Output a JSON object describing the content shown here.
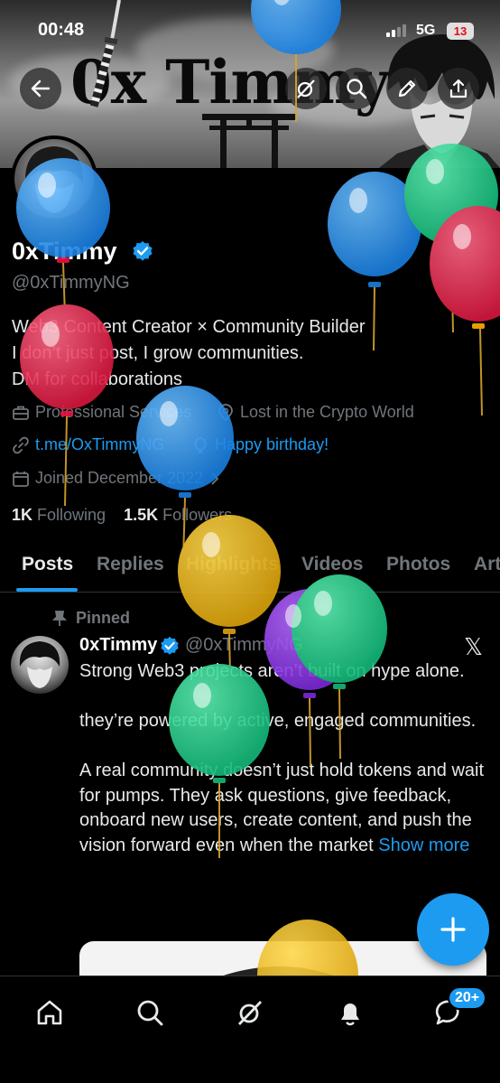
{
  "status_bar": {
    "time": "00:48",
    "network": "5G",
    "battery": "13"
  },
  "banner": {
    "title": "0x Timmy"
  },
  "profile": {
    "display_name": "0xTimmy",
    "handle": "@0xTimmyNG",
    "bio_lines": [
      "Web3 Content Creator × Community Builder",
      "I don’t just post, I grow communities.",
      "DM for collaborations"
    ],
    "category": "Professional Services",
    "location": "Lost in the Crypto World",
    "website": "t.me/OxTimmyNG",
    "birthday": "Happy birthday!",
    "joined": "Joined December 2022",
    "following_count": "1K",
    "following_label": "Following",
    "followers_count": "1.5K",
    "followers_label": "Followers"
  },
  "tabs": [
    "Posts",
    "Replies",
    "Highlights",
    "Videos",
    "Photos",
    "Art"
  ],
  "post": {
    "pinned_label": "Pinned",
    "author": "0xTimmy",
    "handle": "@0xTimmyNG",
    "paragraphs": [
      "Strong Web3 projects aren’t built on hype alone.",
      "they’re powered by active, engaged communities.",
      "A real community doesn’t just hold tokens and wait for pumps. They ask questions, give feedback, onboard new users, create content, and push the vision forward even when the market"
    ],
    "show_more": "Show more"
  },
  "nav": {
    "notifications_badge": "20+"
  },
  "icons": [
    "back-arrow-icon",
    "grok-icon",
    "search-icon",
    "edit-icon",
    "share-icon",
    "briefcase-icon",
    "location-pin-icon",
    "link-icon",
    "balloon-icon",
    "calendar-icon",
    "verified-badge-icon",
    "pin-icon",
    "x-logo-icon",
    "plus-icon",
    "home-icon",
    "messages-icon",
    "bell-icon"
  ],
  "colors": {
    "accent": "#1d9bf0",
    "background": "#000000",
    "secondary_text": "#71767b",
    "primary_text": "#e7e9ea"
  }
}
